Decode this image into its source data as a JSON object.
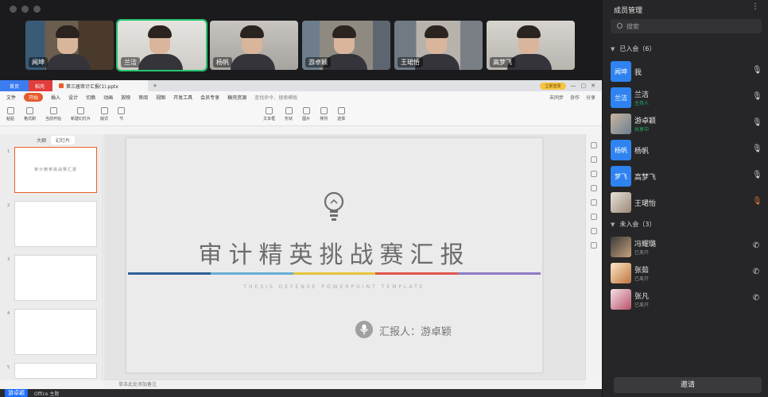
{
  "participants_strip": [
    {
      "name": "闻坤"
    },
    {
      "name": "兰洁"
    },
    {
      "name": "杨帆"
    },
    {
      "name": "游卓颖"
    },
    {
      "name": "王珺怡"
    },
    {
      "name": "高梦飞"
    }
  ],
  "ppt": {
    "tabs": {
      "home": "首页",
      "wps": "稻壳",
      "doc": "第三届审计汇报(1).pptx"
    },
    "login": "立即登录",
    "menu": {
      "file": "文件",
      "start": "开始",
      "insert": "插入",
      "design": "设计",
      "switch": "切换",
      "animation": "动画",
      "show": "放映",
      "review": "审阅",
      "view": "视图",
      "dev": "开发工具",
      "member": "会员专享",
      "template": "稿壳资源",
      "search": "查找命令、搜索模板",
      "sync": "未同步",
      "collab": "协作",
      "share": "分享"
    },
    "ribbon": [
      "粘贴",
      "格式刷",
      "当前开始",
      "新建幻灯片",
      "版式",
      "节",
      "文本框",
      "形状",
      "图片",
      "排列",
      "选择"
    ],
    "thumb_toggle": {
      "outline": "大纲",
      "slides": "幻灯片"
    },
    "thumb_numbers": [
      "1",
      "2",
      "3",
      "4",
      "5"
    ],
    "thumb1_title": "审计精英挑战赛汇报",
    "slide": {
      "title": "审计精英挑战赛汇报",
      "subtitle": "THESIS DEFENSE POWERPOINT TEMPLATE",
      "reporter": "汇报人：游卓颖",
      "bar_colors": [
        "#2f5f98",
        "#6aaed6",
        "#e6c33c",
        "#e2574c",
        "#8e7cc3"
      ]
    },
    "notes": "单击此处添加备注",
    "status": {
      "presenter": "游卓颖",
      "app": "Office 主题"
    }
  },
  "panel": {
    "title": "成员管理",
    "search_placeholder": "搜索",
    "joined_label": "已入会（6）",
    "not_joined_label": "未入会（3）",
    "joined": [
      {
        "avatar": "闻坤",
        "name": "我",
        "sub": ""
      },
      {
        "avatar": "兰洁",
        "name": "兰洁",
        "sub": "主持人"
      },
      {
        "avatar": "",
        "name": "游卓颖",
        "sub": "共享中"
      },
      {
        "avatar": "杨帆",
        "name": "杨帆",
        "sub": ""
      },
      {
        "avatar": "梦飞",
        "name": "高梦飞",
        "sub": ""
      },
      {
        "avatar": "",
        "name": "王珺怡",
        "sub": ""
      }
    ],
    "not_joined": [
      {
        "name": "冯耀璐",
        "sub": "已离开"
      },
      {
        "name": "张茹",
        "sub": "已离开"
      },
      {
        "name": "张凡",
        "sub": "已离开"
      }
    ],
    "invite": "邀请"
  }
}
